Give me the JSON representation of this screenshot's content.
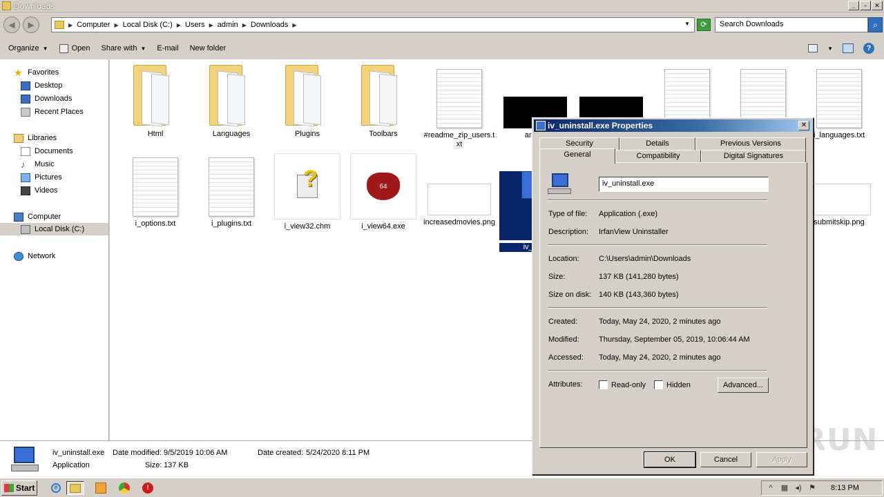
{
  "window": {
    "title": "Downloads"
  },
  "address": {
    "crumbs": [
      "Computer",
      "Local Disk (C:)",
      "Users",
      "admin",
      "Downloads"
    ],
    "search_placeholder": "Search Downloads"
  },
  "toolbar": {
    "organize": "Organize",
    "open": "Open",
    "share_with": "Share with",
    "email": "E-mail",
    "new_folder": "New folder"
  },
  "nav": {
    "favorites": "Favorites",
    "desktop": "Desktop",
    "downloads": "Downloads",
    "recent": "Recent Places",
    "libraries": "Libraries",
    "documents": "Documents",
    "music": "Music",
    "pictures": "Pictures",
    "videos": "Videos",
    "computer": "Computer",
    "local_disk": "Local Disk (C:)",
    "network": "Network"
  },
  "files": {
    "html": "Html",
    "languages": "Languages",
    "plugins": "Plugins",
    "toolbars": "Toolbars",
    "readme": "#readme_zip_users.txt",
    "annual": "annua",
    "languages_txt": "i_languages.txt",
    "options": "i_options.txt",
    "plugins_txt": "i_plugins.txt",
    "view32": "i_view32.chm",
    "view64": "i_view64.exe",
    "view64_badge": "64",
    "increased": "increasedmovies.png",
    "uninstall": "iv_unin",
    "submitskip": "submitskip.png"
  },
  "details": {
    "name": "iv_uninstall.exe",
    "type": "Application",
    "modified_label": "Date modified:",
    "modified": "9/5/2019 10:06 AM",
    "created_label": "Date created:",
    "created": "5/24/2020 8:11 PM",
    "size_label": "Size:",
    "size": "137 KB"
  },
  "dialog": {
    "title": "iv_uninstall.exe Properties",
    "tabs": {
      "security": "Security",
      "details": "Details",
      "previous": "Previous Versions",
      "general": "General",
      "compatibility": "Compatibility",
      "signatures": "Digital Signatures"
    },
    "filename": "iv_uninstall.exe",
    "type_label": "Type of file:",
    "type": "Application (.exe)",
    "desc_label": "Description:",
    "desc": "IrfanView Uninstaller",
    "location_label": "Location:",
    "location": "C:\\Users\\admin\\Downloads",
    "size_label": "Size:",
    "size": "137 KB (141,280 bytes)",
    "disk_label": "Size on disk:",
    "disk": "140 KB (143,360 bytes)",
    "created_label": "Created:",
    "created": "Today, May 24, 2020, 2 minutes ago",
    "modified_label": "Modified:",
    "modified": "Thursday, September 05, 2019, 10:06:44 AM",
    "accessed_label": "Accessed:",
    "accessed": "Today, May 24, 2020, 2 minutes ago",
    "attributes_label": "Attributes:",
    "readonly": "Read-only",
    "hidden": "Hidden",
    "advanced": "Advanced...",
    "ok": "OK",
    "cancel": "Cancel",
    "apply": "Apply"
  },
  "taskbar": {
    "start": "Start",
    "clock": "8:13 PM"
  },
  "watermark": "ANY RUN"
}
